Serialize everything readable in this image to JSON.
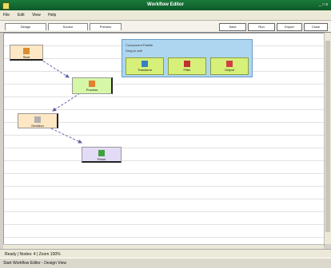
{
  "window": {
    "title": "Workflow Editor",
    "controls": "_ □ x"
  },
  "menu": {
    "items": [
      "File",
      "Edit",
      "View",
      "Help"
    ]
  },
  "tabs": [
    "Design",
    "Source",
    "Preview"
  ],
  "toolbar": {
    "buttons": [
      "Save",
      "Run",
      "Export",
      "Close"
    ]
  },
  "palette": {
    "title": "Component Palette",
    "subtitle": "Drag to add",
    "items": [
      {
        "label": "Transform",
        "icon": "transform-icon"
      },
      {
        "label": "Filter",
        "icon": "filter-icon"
      },
      {
        "label": "Output",
        "icon": "output-icon"
      }
    ]
  },
  "nodes": [
    {
      "id": "start",
      "label": "Start",
      "icon": "start-icon"
    },
    {
      "id": "process",
      "label": "Process",
      "icon": "process-icon"
    },
    {
      "id": "decision",
      "label": "Decision",
      "icon": "decision-icon"
    },
    {
      "id": "end",
      "label": "Finish",
      "icon": "finish-icon"
    }
  ],
  "status": {
    "text": "Ready  |  Nodes: 4  |  Zoom 100%"
  },
  "taskbar": {
    "text": "Start  Workflow Editor - Design View"
  },
  "colors": {
    "titlebar": "#1a7a3a",
    "palette": "#aed6f0",
    "palette_item": "#d6f07a",
    "node_start": "#fde7c4",
    "node_process": "#d6f7a8",
    "node_end": "#e4dcf7"
  }
}
